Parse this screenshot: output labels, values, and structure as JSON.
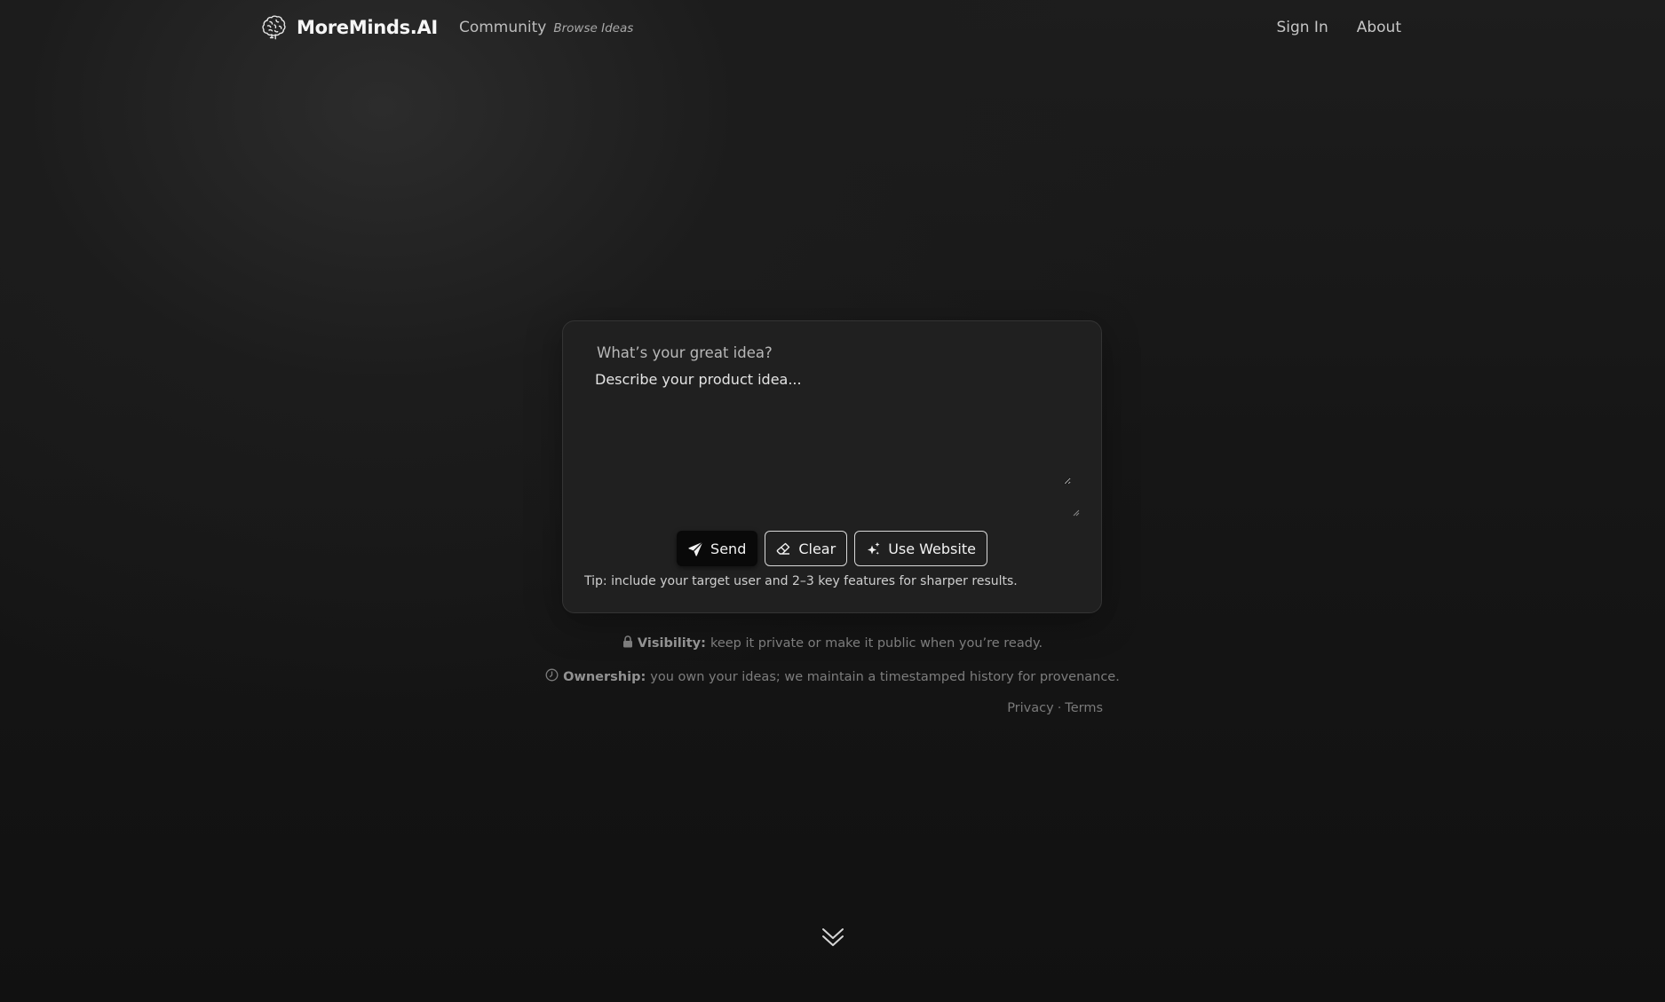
{
  "nav": {
    "brand_name": "MoreMinds.AI",
    "community_label": "Community",
    "browse_label": "Browse Ideas",
    "sign_in_label": "Sign In",
    "about_label": "About",
    "brand_icon": "brain-icon"
  },
  "composer": {
    "label": "What’s your great idea?",
    "placeholder": "Describe your product idea...",
    "value": "",
    "send_label": "Send",
    "clear_label": "Clear",
    "use_website_label": "Use Website",
    "tip": "Tip: include your target user and 2–3 key features for sharper results."
  },
  "info": {
    "visibility_title": "Visibility:",
    "visibility_text": "keep it private or make it public when you’re ready.",
    "ownership_title": "Ownership:",
    "ownership_text": "you own your ideas; we maintain a timestamped history for provenance."
  },
  "footer": {
    "privacy_label": "Privacy",
    "separator": "·",
    "terms_label": "Terms"
  },
  "colors": {
    "background": "#121212",
    "card": "#202020",
    "send_button": "#090909"
  }
}
